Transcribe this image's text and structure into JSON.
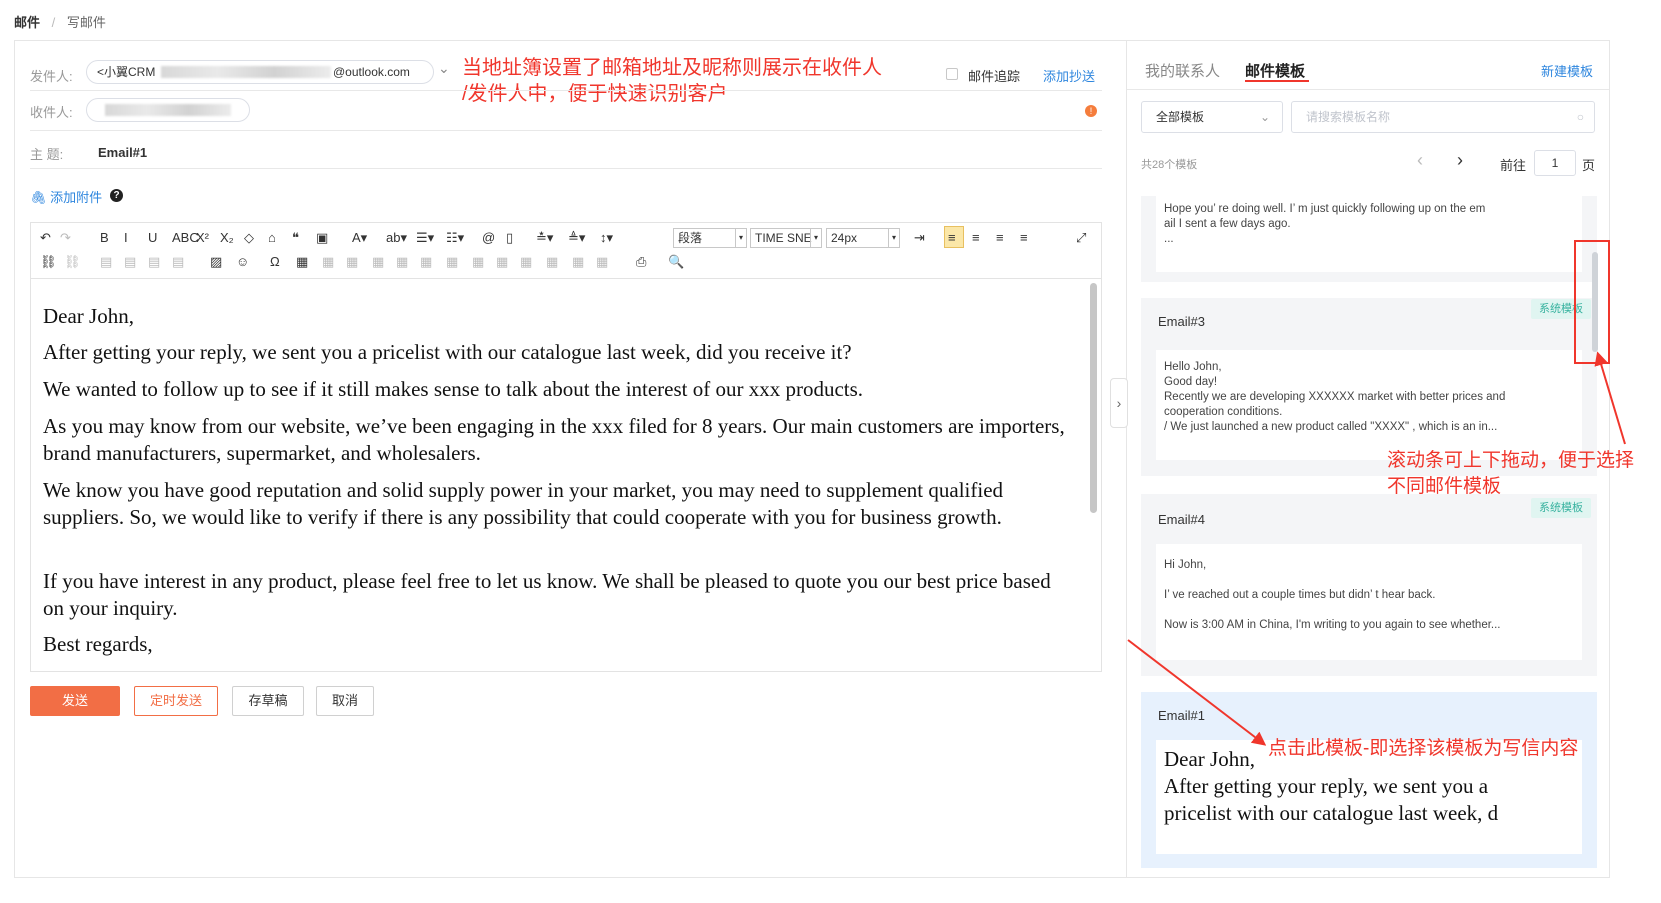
{
  "breadcrumb": {
    "root": "邮件",
    "separator": "/",
    "current": "写邮件"
  },
  "compose": {
    "from_label": "发件人:",
    "from_name_prefix": "<小翼CRM",
    "from_domain": "@outlook.com",
    "to_label": "收件人:",
    "subject_label": "主 题:",
    "subject_value": "Email#1",
    "attach_label": "添加附件",
    "help_glyph": "?",
    "tracking_label": "邮件追踪",
    "add_cc_label": "添加抄送",
    "chevron_glyph": "⌄",
    "warning_dot": "!"
  },
  "toolbar": {
    "row1": [
      {
        "icon": "undo-icon",
        "glyph": "↶",
        "gray": false
      },
      {
        "icon": "redo-icon",
        "glyph": "↷",
        "gray": true
      },
      {
        "icon": "bold-icon",
        "glyph": "B",
        "gray": false
      },
      {
        "icon": "italic-icon",
        "glyph": "I",
        "gray": false
      },
      {
        "icon": "underline-icon",
        "glyph": "U",
        "gray": false
      },
      {
        "icon": "strikethrough-icon",
        "glyph": "ABC",
        "gray": false
      },
      {
        "icon": "superscript-icon",
        "glyph": "X²",
        "gray": false
      },
      {
        "icon": "subscript-icon",
        "glyph": "X₂",
        "gray": false
      },
      {
        "icon": "eraser-icon",
        "glyph": "◇",
        "gray": false
      },
      {
        "icon": "format-painter-icon",
        "glyph": "⌂",
        "gray": false
      },
      {
        "icon": "blockquote-icon",
        "glyph": "❝",
        "gray": false
      },
      {
        "icon": "paste-plain-icon",
        "glyph": "▣",
        "gray": false
      },
      {
        "icon": "font-color-icon",
        "glyph": "A▾",
        "gray": false
      },
      {
        "icon": "highlight-icon",
        "glyph": "ab▾",
        "gray": false
      },
      {
        "icon": "ordered-list-icon",
        "glyph": "☰▾",
        "gray": false
      },
      {
        "icon": "unordered-list-icon",
        "glyph": "☷▾",
        "gray": false
      },
      {
        "icon": "anchor-icon",
        "glyph": "@",
        "gray": false
      },
      {
        "icon": "page-icon",
        "glyph": "▯",
        "gray": false
      },
      {
        "icon": "paragraph-spacing-icon",
        "glyph": "≛▾",
        "gray": false
      },
      {
        "icon": "row-spacing-icon",
        "glyph": "≜▾",
        "gray": false
      },
      {
        "icon": "line-height-icon",
        "glyph": "↕▾",
        "gray": false
      }
    ],
    "paragraph_select": "段落",
    "font_select": "TIME SNE",
    "size_select": "24px",
    "dropdown_arrow": "▾",
    "row1_right": [
      {
        "icon": "indent-icon",
        "glyph": "⇥"
      },
      {
        "icon": "align-left-icon",
        "glyph": "≡"
      },
      {
        "icon": "align-center-icon",
        "glyph": "≡"
      },
      {
        "icon": "align-right-icon",
        "glyph": "≡"
      },
      {
        "icon": "align-justify-icon",
        "glyph": "≡"
      },
      {
        "icon": "fullscreen-icon",
        "glyph": "⤢"
      }
    ],
    "row2": [
      {
        "icon": "link-icon",
        "glyph": "⛓",
        "gray": false
      },
      {
        "icon": "unlink-icon",
        "glyph": "⛓",
        "gray": true
      },
      {
        "icon": "image-float-none-icon",
        "glyph": "▤",
        "gray": true
      },
      {
        "icon": "image-float-left-icon",
        "glyph": "▤",
        "gray": true
      },
      {
        "icon": "image-float-right-icon",
        "glyph": "▤",
        "gray": true
      },
      {
        "icon": "image-center-icon",
        "glyph": "▤",
        "gray": true
      },
      {
        "icon": "image-icon",
        "glyph": "▨",
        "gray": false
      },
      {
        "icon": "emoji-icon",
        "glyph": "☺",
        "gray": false
      },
      {
        "icon": "special-char-icon",
        "glyph": "Ω",
        "gray": false
      },
      {
        "icon": "table-icon",
        "glyph": "▦",
        "gray": false
      },
      {
        "icon": "insert-row-before-icon",
        "glyph": "▦",
        "gray": true
      },
      {
        "icon": "insert-col-before-icon",
        "glyph": "▦",
        "gray": true
      },
      {
        "icon": "delete-row-icon",
        "glyph": "▦",
        "gray": true
      },
      {
        "icon": "delete-col-icon",
        "glyph": "▦",
        "gray": true
      },
      {
        "icon": "merge-right-icon",
        "glyph": "▦",
        "gray": true
      },
      {
        "icon": "merge-down-icon",
        "glyph": "▦",
        "gray": true
      },
      {
        "icon": "merge-cells-icon",
        "glyph": "▦",
        "gray": true
      },
      {
        "icon": "split-cells-icon",
        "glyph": "▦",
        "gray": true
      },
      {
        "icon": "split-rows-icon",
        "glyph": "▦",
        "gray": true
      },
      {
        "icon": "split-cols-icon",
        "glyph": "▦",
        "gray": true
      },
      {
        "icon": "table-props-icon",
        "glyph": "▦",
        "gray": true
      },
      {
        "icon": "clear-table-icon",
        "glyph": "▦",
        "gray": true
      },
      {
        "icon": "print-icon",
        "glyph": "⎙",
        "gray": false
      },
      {
        "icon": "preview-icon",
        "glyph": "🔍",
        "gray": false
      }
    ]
  },
  "editor": {
    "paragraphs": [
      "Dear John,",
      "After getting your reply, we sent you a pricelist with our catalogue last week, did you receive it?",
      "We wanted to follow up to see if it still makes sense to talk about the interest of our xxx products.",
      "As you may know from our website, we’ve been engaging in the xxx filed for 8 years. Our main customers are importers, brand manufacturers, supermarket, and wholesalers.",
      "We know you have good reputation and solid supply power in your market, you may need to supplement qualified suppliers. So, we would like to verify if there is any possibility that could cooperate with you for business growth.",
      "If you have interest in any product, please feel free to let us know. We shall be pleased to quote you our best price based on your inquiry.",
      "Best regards,"
    ]
  },
  "actions": {
    "send": "发送",
    "schedule": "定时发送",
    "draft": "存草稿",
    "cancel": "取消"
  },
  "collapse_glyph": "›",
  "side": {
    "tabs": [
      {
        "label": "我的联系人",
        "active": false
      },
      {
        "label": "邮件模板",
        "active": true
      }
    ],
    "new_template": "新建模板",
    "filter_select": "全部模板",
    "filter_arrow": "⌄",
    "search_placeholder": "请搜索模板名称",
    "search_glyph": "○",
    "total_text": "共28个模板",
    "prev_glyph": "‹",
    "next_glyph": "›",
    "goto_label": "前往",
    "page_value": "1",
    "page_suffix": "页",
    "badge_label": "系统模板",
    "templates": [
      {
        "title": "",
        "lines": [
          "Hope you’ re doing well. I’ m just quickly following up on the em",
          "ail I sent a few days ago.",
          "..."
        ]
      },
      {
        "title": "Email#3",
        "lines": [
          "Hello John,",
          "Good day!",
          "Recently we are developing XXXXXX market with better prices and",
          "cooperation conditions.",
          "/ We just launched a new product called  \"XXXX\" , which is an in..."
        ]
      },
      {
        "title": "Email#4",
        "lines": [
          "Hi John,",
          "",
          "I’ ve reached out a couple times but didn’ t hear back.",
          "",
          "Now is 3:00 AM in China, I'm writing to you again to see whether..."
        ]
      },
      {
        "title": "Email#1",
        "lines": [
          "Dear John,",
          "After getting your reply, we sent you a",
          "pricelist with our catalogue last week, d"
        ]
      }
    ]
  },
  "annotations": {
    "note1_line1": "当地址簿设置了邮箱地址及昵称则展示在收件人",
    "note1_line2": "/发件人中，便于快速识别客户",
    "note2_line1": "滚动条可上下拖动，便于选择",
    "note2_line2": "不同邮件模板",
    "note3": "点击此模板-即选择该模板为写信内容"
  },
  "colors": {
    "accent_red": "#f0362c",
    "primary_orange": "#f26e45",
    "link_blue": "#2e86de",
    "badge_green": "#37b29f"
  }
}
